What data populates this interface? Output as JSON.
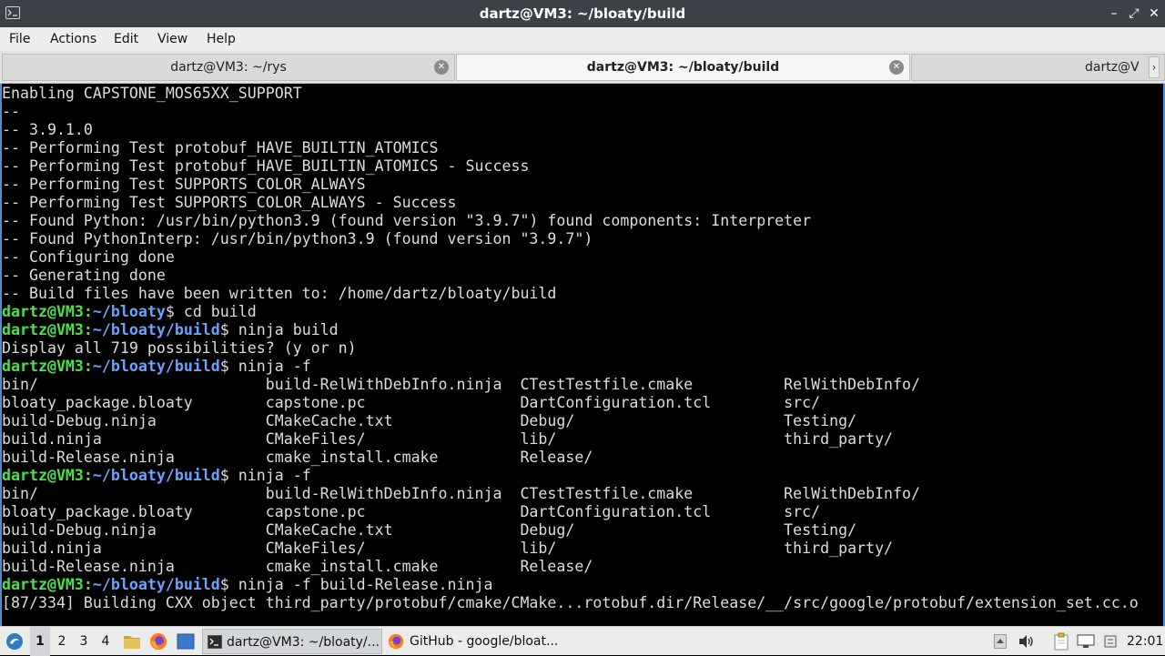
{
  "window": {
    "title": "dartz@VM3: ~/bloaty/build"
  },
  "menu": {
    "items": [
      "File",
      "Actions",
      "Edit",
      "View",
      "Help"
    ]
  },
  "tabs": [
    {
      "label": "dartz@VM3: ~/rys"
    },
    {
      "label": "dartz@VM3: ~/bloaty/build"
    },
    {
      "label": "dartz@V"
    }
  ],
  "terminal": {
    "lines": [
      "Enabling CAPSTONE_MOS65XX_SUPPORT",
      "--",
      "-- 3.9.1.0",
      "-- Performing Test protobuf_HAVE_BUILTIN_ATOMICS",
      "-- Performing Test protobuf_HAVE_BUILTIN_ATOMICS - Success",
      "-- Performing Test SUPPORTS_COLOR_ALWAYS",
      "-- Performing Test SUPPORTS_COLOR_ALWAYS - Success",
      "-- Found Python: /usr/bin/python3.9 (found version \"3.9.7\") found components: Interpreter",
      "-- Found PythonInterp: /usr/bin/python3.9 (found version \"3.9.7\")",
      "-- Configuring done",
      "-- Generating done",
      "-- Build files have been written to: /home/dartz/bloaty/build",
      {
        "user": "dartz@VM3",
        "path": "~/bloaty",
        "cmd": "$ cd build"
      },
      {
        "user": "dartz@VM3",
        "path": "~/bloaty/build",
        "cmd": "$ ninja build"
      },
      "Display all 719 possibilities? (y or n)",
      {
        "user": "dartz@VM3",
        "path": "~/bloaty/build",
        "cmd": "$ ninja -f"
      },
      "bin/                         build-RelWithDebInfo.ninja  CTestTestfile.cmake          RelWithDebInfo/",
      "bloaty_package.bloaty        capstone.pc                 DartConfiguration.tcl        src/",
      "build-Debug.ninja            CMakeCache.txt              Debug/                       Testing/",
      "build.ninja                  CMakeFiles/                 lib/                         third_party/",
      "build-Release.ninja          cmake_install.cmake         Release/",
      {
        "user": "dartz@VM3",
        "path": "~/bloaty/build",
        "cmd": "$ ninja -f"
      },
      "bin/                         build-RelWithDebInfo.ninja  CTestTestfile.cmake          RelWithDebInfo/",
      "bloaty_package.bloaty        capstone.pc                 DartConfiguration.tcl        src/",
      "build-Debug.ninja            CMakeCache.txt              Debug/                       Testing/",
      "build.ninja                  CMakeFiles/                 lib/                         third_party/",
      "build-Release.ninja          cmake_install.cmake         Release/",
      {
        "user": "dartz@VM3",
        "path": "~/bloaty/build",
        "cmd": "$ ninja -f build-Release.ninja"
      },
      "[87/334] Building CXX object third_party/protobuf/cmake/CMake...rotobuf.dir/Release/__/src/google/protobuf/extension_set.cc.o"
    ]
  },
  "taskbar": {
    "workspaces": [
      "1",
      "2",
      "3",
      "4"
    ],
    "active_workspace": "1",
    "tasks": [
      {
        "label": "dartz@VM3: ~/bloaty/...",
        "icon": "terminal-icon"
      },
      {
        "label": "GitHub - google/bloat...",
        "icon": "firefox-icon"
      }
    ],
    "clock": "22:01"
  },
  "colors": {
    "prompt_user": "#4ee14e",
    "prompt_path": "#6aa3ff",
    "terminal_bg": "#000000",
    "terminal_fg": "#dcdcdc",
    "active_border": "#4a8fd0"
  }
}
